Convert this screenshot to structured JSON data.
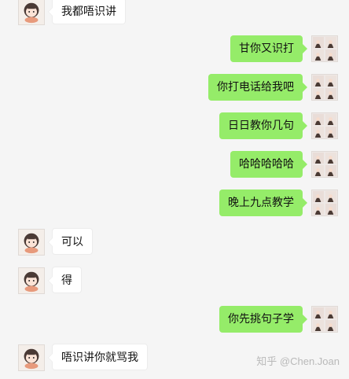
{
  "colors": {
    "background": "#f5f5f5",
    "bubble_outgoing": "#95ec69",
    "bubble_incoming": "#ffffff"
  },
  "messages": [
    {
      "from": "other",
      "text": "我都唔识讲",
      "avatar": "girl-cartoon-avatar"
    },
    {
      "from": "me",
      "text": "甘你又识打",
      "avatar": "photo-collage-avatar"
    },
    {
      "from": "me",
      "text": "你打电话给我吧",
      "avatar": "photo-collage-avatar"
    },
    {
      "from": "me",
      "text": "日日教你几句",
      "avatar": "photo-collage-avatar"
    },
    {
      "from": "me",
      "text": "哈哈哈哈哈",
      "avatar": "photo-collage-avatar"
    },
    {
      "from": "me",
      "text": "晚上九点教学",
      "avatar": "photo-collage-avatar"
    },
    {
      "from": "other",
      "text": "可以",
      "avatar": "girl-cartoon-avatar"
    },
    {
      "from": "other",
      "text": "得",
      "avatar": "girl-cartoon-avatar"
    },
    {
      "from": "me",
      "text": "你先挑句子学",
      "avatar": "photo-collage-avatar"
    },
    {
      "from": "other",
      "text": "唔识讲你就骂我",
      "avatar": "girl-cartoon-avatar"
    }
  ],
  "watermark": "知乎 @Chen.Joan"
}
